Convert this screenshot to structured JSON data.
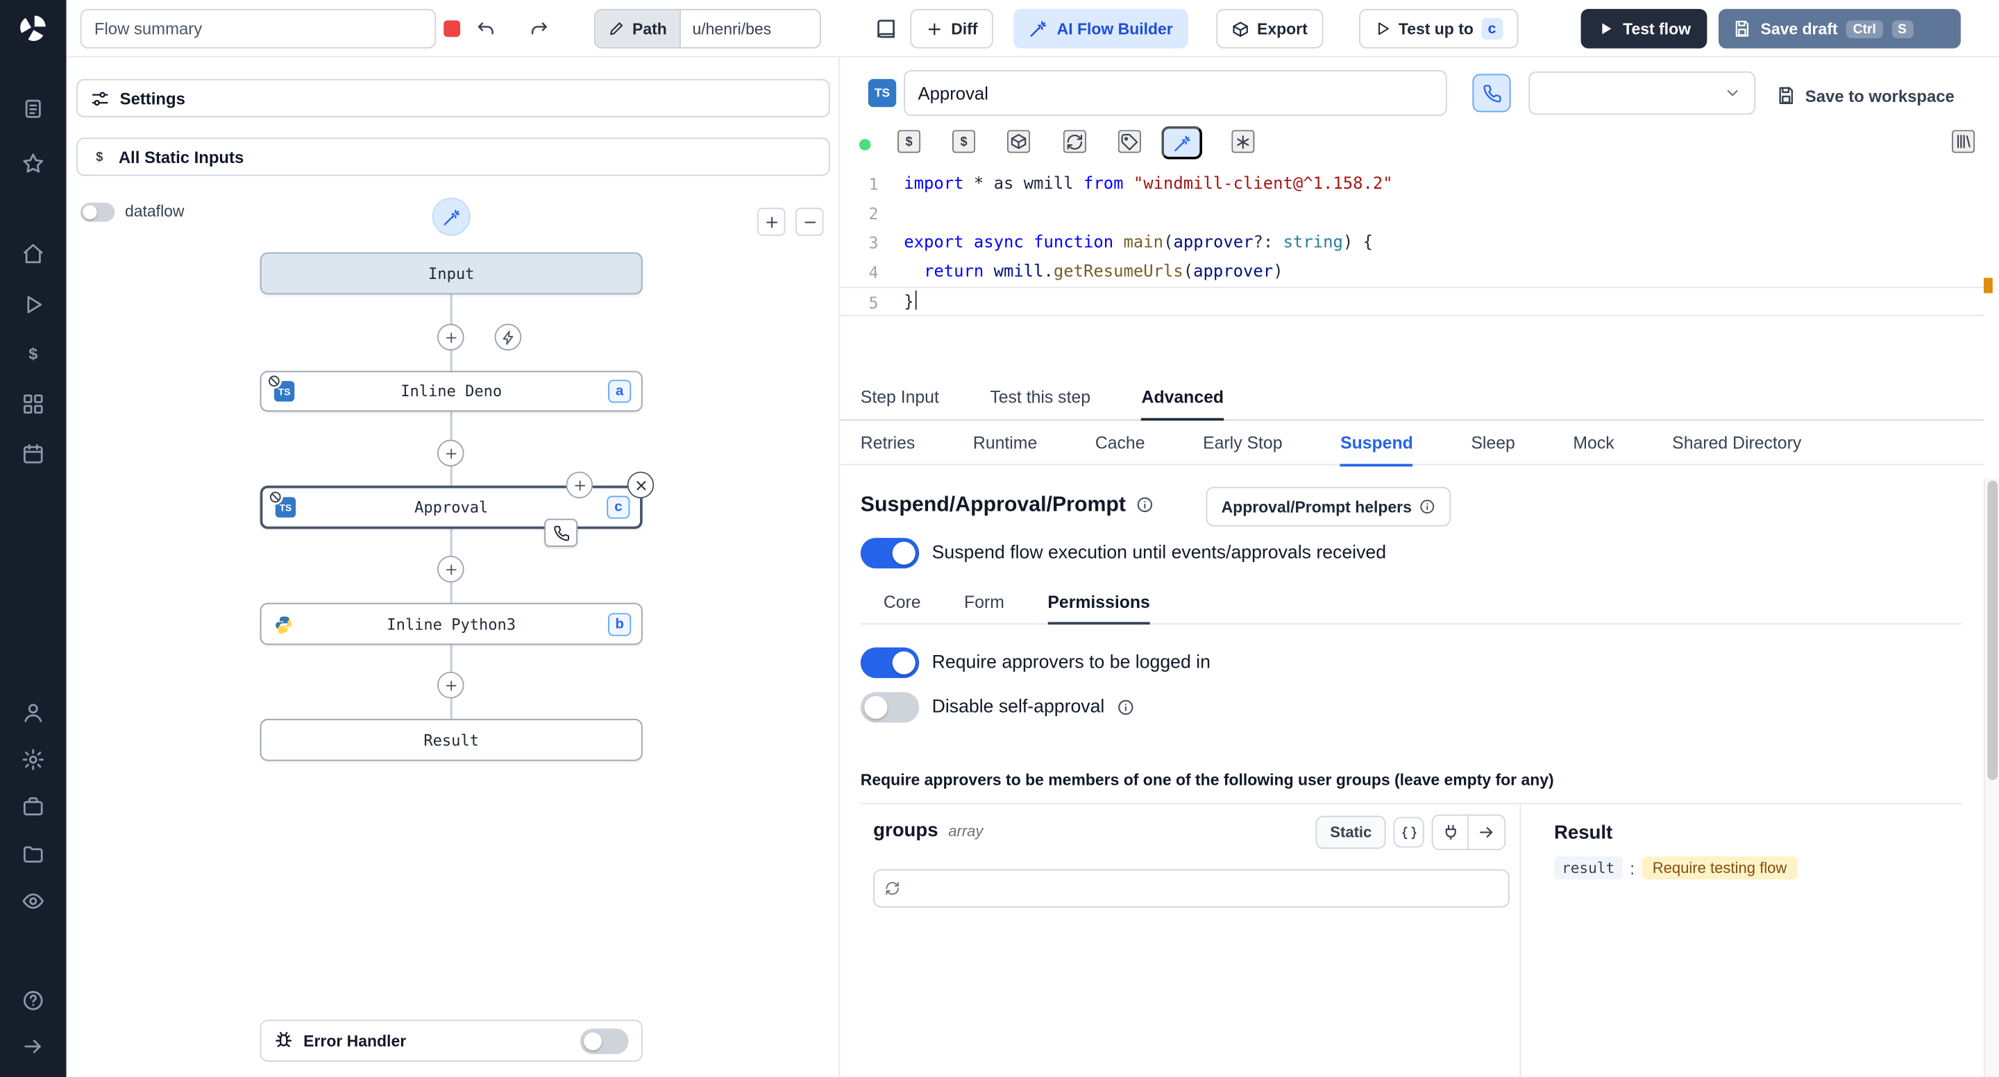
{
  "sidebar": {
    "icons": [
      "windmill-logo",
      "runs",
      "favorites",
      "home",
      "jobs",
      "variables",
      "resources",
      "schedules",
      "users",
      "settings",
      "workers",
      "folders",
      "audit-logs",
      "help",
      "collapse-sidebar"
    ]
  },
  "topbar": {
    "flow_summary_placeholder": "Flow summary",
    "path_label": "Path",
    "path_value": "u/henri/bes",
    "diff_label": "Diff",
    "ai_flow_builder_label": "AI Flow Builder",
    "export_label": "Export",
    "test_up_to_label": "Test up to",
    "test_up_to_badge": "c",
    "test_flow_label": "Test flow",
    "save_draft_label": "Save draft",
    "save_draft_shortcut": [
      "Ctrl",
      "S"
    ]
  },
  "flow_panel": {
    "settings_label": "Settings",
    "static_inputs_label": "All Static Inputs",
    "dataflow_label": "dataflow",
    "error_handler_label": "Error Handler",
    "zoom_in_label": "+",
    "zoom_out_label": "−",
    "nodes": {
      "input": {
        "label": "Input"
      },
      "deno": {
        "label": "Inline Deno",
        "badge": "a"
      },
      "approval": {
        "label": "Approval",
        "badge": "c"
      },
      "python": {
        "label": "Inline Python3",
        "badge": "b"
      },
      "result": {
        "label": "Result"
      }
    }
  },
  "editor": {
    "language_badge": "TS",
    "step_name": "Approval",
    "save_to_workspace_label": "Save to workspace",
    "current_line": 5,
    "code_lines": [
      [
        [
          "kw",
          "import"
        ],
        [
          "pl",
          " * as wmill "
        ],
        [
          "kw",
          "from"
        ],
        [
          "pl",
          " "
        ],
        [
          "str",
          "\"windmill-client@^1.158.2\""
        ]
      ],
      [],
      [
        [
          "kw",
          "export"
        ],
        [
          "pl",
          " "
        ],
        [
          "kw",
          "async"
        ],
        [
          "pl",
          " "
        ],
        [
          "kw",
          "function"
        ],
        [
          "pl",
          " "
        ],
        [
          "fn",
          "main"
        ],
        [
          "pl",
          "("
        ],
        [
          "id",
          "approver"
        ],
        [
          "pl",
          "?: "
        ],
        [
          "ty",
          "string"
        ],
        [
          "pl",
          ") {"
        ]
      ],
      [
        [
          "pl",
          "  "
        ],
        [
          "kw",
          "return"
        ],
        [
          "pl",
          " "
        ],
        [
          "id",
          "wmill"
        ],
        [
          "pl",
          "."
        ],
        [
          "fn",
          "getResumeUrls"
        ],
        [
          "pl",
          "("
        ],
        [
          "id",
          "approver"
        ],
        [
          "pl",
          ")"
        ]
      ],
      [
        [
          "pl",
          "}"
        ]
      ]
    ]
  },
  "tabs": {
    "main": [
      "Step Input",
      "Test this step",
      "Advanced"
    ],
    "main_active": "Advanced",
    "advanced": [
      "Retries",
      "Runtime",
      "Cache",
      "Early Stop",
      "Suspend",
      "Sleep",
      "Mock",
      "Shared Directory"
    ],
    "advanced_active": "Suspend"
  },
  "suspend": {
    "title": "Suspend/Approval/Prompt",
    "helpers_button_label": "Approval/Prompt helpers",
    "suspend_toggle_label": "Suspend flow execution until events/approvals received",
    "sub_tabs": [
      "Core",
      "Form",
      "Permissions"
    ],
    "sub_tabs_active": "Permissions",
    "require_login_label": "Require approvers to be logged in",
    "disable_self_approval_label": "Disable self-approval",
    "groups_heading": "Require approvers to be members of one of the following user groups (leave empty for any)",
    "groups": {
      "name": "groups",
      "type": "array",
      "static_label": "Static"
    },
    "result": {
      "title": "Result",
      "key": "result",
      "value": "Require testing flow"
    }
  },
  "colors": {
    "accent_blue": "#2563eb",
    "ai_button_bg": "#dbeafe",
    "test_flow_bg": "#232c3d",
    "save_draft_bg": "#5e7698",
    "result_value_bg": "#fef3c7"
  }
}
